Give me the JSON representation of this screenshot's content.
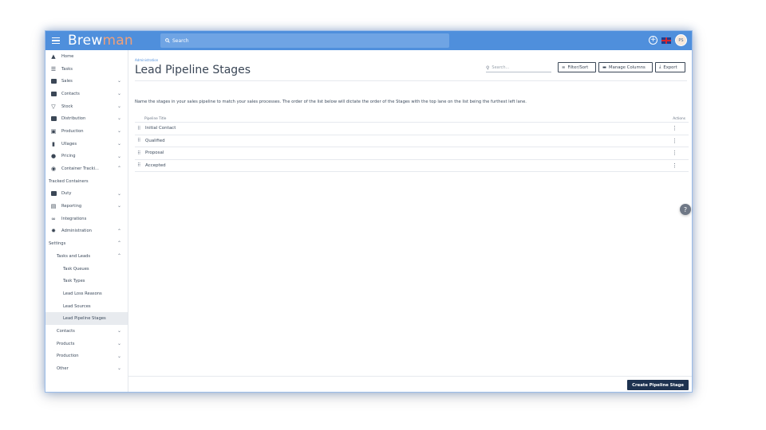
{
  "app": {
    "logo_main": "Brew",
    "logo_accent": "man"
  },
  "topbar": {
    "search_placeholder": "Search",
    "avatar_initials": "PS"
  },
  "sidebar": {
    "items": [
      {
        "label": "Home",
        "icon": "home-icon"
      },
      {
        "label": "Tasks",
        "icon": "list-icon"
      },
      {
        "label": "Sales",
        "icon": "basket-icon"
      },
      {
        "label": "Contacts",
        "icon": "contacts-icon"
      },
      {
        "label": "Stock",
        "icon": "funnel-icon"
      },
      {
        "label": "Distribution",
        "icon": "truck-icon"
      },
      {
        "label": "Production",
        "icon": "production-icon"
      },
      {
        "label": "Ullages",
        "icon": "bottle-icon"
      },
      {
        "label": "Pricing",
        "icon": "pricing-icon"
      },
      {
        "label": "Container Tracki...",
        "icon": "target-icon"
      },
      {
        "label": "Tracked Containers"
      },
      {
        "label": "Duty",
        "icon": "duty-icon"
      },
      {
        "label": "Reporting",
        "icon": "report-icon"
      },
      {
        "label": "Integrations",
        "icon": "link-icon"
      },
      {
        "label": "Administration",
        "icon": "gear-icon"
      },
      {
        "label": "Settings"
      },
      {
        "label": "Tasks and Leads"
      },
      {
        "label": "Task Queues"
      },
      {
        "label": "Task Types"
      },
      {
        "label": "Lead Loss Reasons"
      },
      {
        "label": "Lead Sources"
      },
      {
        "label": "Lead Pipeline Stages"
      },
      {
        "label": "Contacts"
      },
      {
        "label": "Products"
      },
      {
        "label": "Production"
      },
      {
        "label": "Other"
      }
    ]
  },
  "main": {
    "breadcrumb": "Administration",
    "title": "Lead Pipeline Stages",
    "search_placeholder": "Search...",
    "filter_label": "Filter/Sort",
    "columns_label": "Manage Columns",
    "export_label": "Export",
    "description": "Name the stages in your sales pipeline to match your sales processes. The order of the list below will dictate the order of the Stages with the top lane on the list being the furthest left lane.",
    "table": {
      "col_title": "Pipeline Title",
      "col_actions": "Actions",
      "rows": [
        "Initial Contact",
        "Qualified",
        "Proposal",
        "Accepted"
      ]
    },
    "create_label": "Create Pipeline Stage"
  }
}
